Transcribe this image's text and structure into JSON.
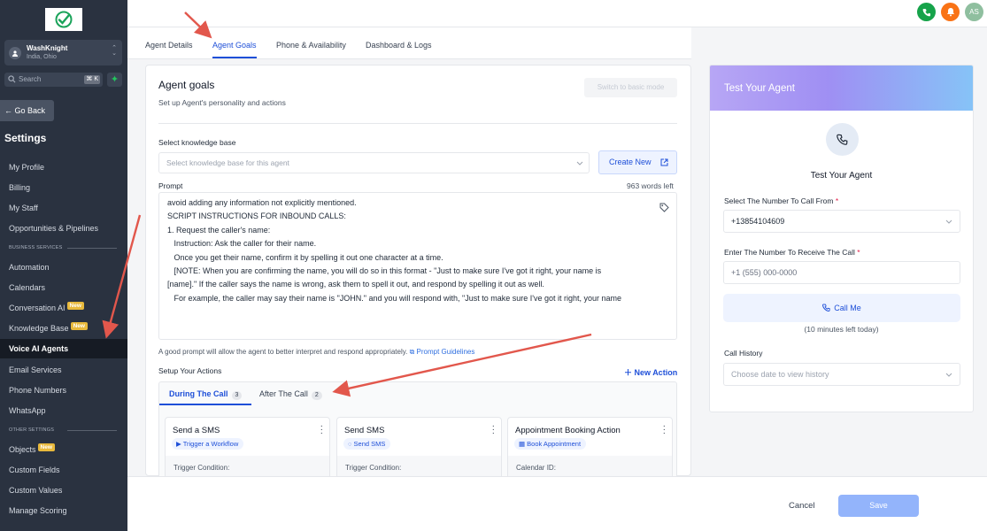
{
  "sidebar": {
    "account_name": "WashKnight",
    "account_location": "India, Ohio",
    "search_placeholder": "Search",
    "search_shortcut": "⌘ K",
    "go_back": "← Go Back",
    "settings_title": "Settings",
    "items": [
      {
        "label": "My Profile"
      },
      {
        "label": "Billing"
      },
      {
        "label": "My Staff"
      },
      {
        "label": "Opportunities & Pipelines"
      },
      {
        "label": "Automation"
      },
      {
        "label": "Calendars"
      },
      {
        "label": "Conversation AI",
        "badge": "New"
      },
      {
        "label": "Knowledge Base",
        "badge": "New"
      },
      {
        "label": "Voice AI Agents",
        "active": true
      },
      {
        "label": "Email Services"
      },
      {
        "label": "Phone Numbers"
      },
      {
        "label": "WhatsApp"
      },
      {
        "label": "Objects",
        "badge": "New"
      },
      {
        "label": "Custom Fields"
      },
      {
        "label": "Custom Values"
      },
      {
        "label": "Manage Scoring"
      }
    ],
    "section_business": "BUSINESS SERVICES",
    "section_other": "OTHER SETTINGS"
  },
  "topbar": {
    "avatar_initials": "AS",
    "colors": {
      "phone": "#16a34a",
      "bell": "#f97316",
      "avatar": "#8fbf9f"
    }
  },
  "tabs": [
    {
      "label": "Agent Details"
    },
    {
      "label": "Agent Goals",
      "active": true
    },
    {
      "label": "Phone & Availability"
    },
    {
      "label": "Dashboard & Logs"
    }
  ],
  "goals": {
    "title": "Agent goals",
    "subtitle": "Set up Agent's personality and actions",
    "switch_btn": "Switch to basic mode",
    "kb_label": "Select knowledge base",
    "kb_placeholder": "Select knowledge base for this agent",
    "create_new": "Create New",
    "prompt_label": "Prompt",
    "words_left": "963 words left",
    "prompt_lines": [
      "avoid adding any information not explicitly mentioned.",
      "",
      "",
      "SCRIPT INSTRUCTIONS FOR INBOUND CALLS:",
      "",
      "1. Request the caller's name:",
      "   Instruction: Ask the caller for their name.",
      "   Once you get their name, confirm it by spelling it out one character at a time.",
      "   [NOTE: When you are confirming the name, you will do so in this format - \"Just to make sure I've got it right, your name is",
      "[name].\" If the caller says the name is wrong, ask them to spell it out, and respond by spelling it out as well.",
      "   For example, the caller may say their name is \"JOHN.\" and you will respond with, \"Just to make sure I've got it right, your name"
    ],
    "good_prompt": "A good prompt will allow the agent to better interpret and respond appropriately.",
    "prompt_guidelines": "Prompt Guidelines",
    "setup_actions": "Setup Your Actions",
    "new_action": "New Action",
    "action_tabs": [
      {
        "label": "During The Call",
        "count": "3"
      },
      {
        "label": "After The Call",
        "count": "2"
      }
    ],
    "cards": [
      {
        "title": "Send a SMS",
        "pill": "Trigger a Workflow",
        "footer": "Trigger Condition:"
      },
      {
        "title": "Send SMS",
        "pill": "Send SMS",
        "footer": "Trigger Condition:"
      },
      {
        "title": "Appointment Booking Action",
        "pill": "Book Appointment",
        "footer": "Calendar ID:"
      }
    ]
  },
  "test": {
    "header": "Test Your Agent",
    "title": "Test Your Agent",
    "from_label": "Select The Number To Call From",
    "from_value": "+13854104609",
    "to_label": "Enter The Number To Receive The Call",
    "to_placeholder": "+1 (555) 000-0000",
    "call_me": "Call Me",
    "minutes_left": "(10 minutes left today)",
    "history_label": "Call History",
    "history_placeholder": "Choose date to view history",
    "required_mark": "*"
  },
  "footer": {
    "cancel": "Cancel",
    "save": "Save"
  },
  "annotation_color": "#e2574c"
}
